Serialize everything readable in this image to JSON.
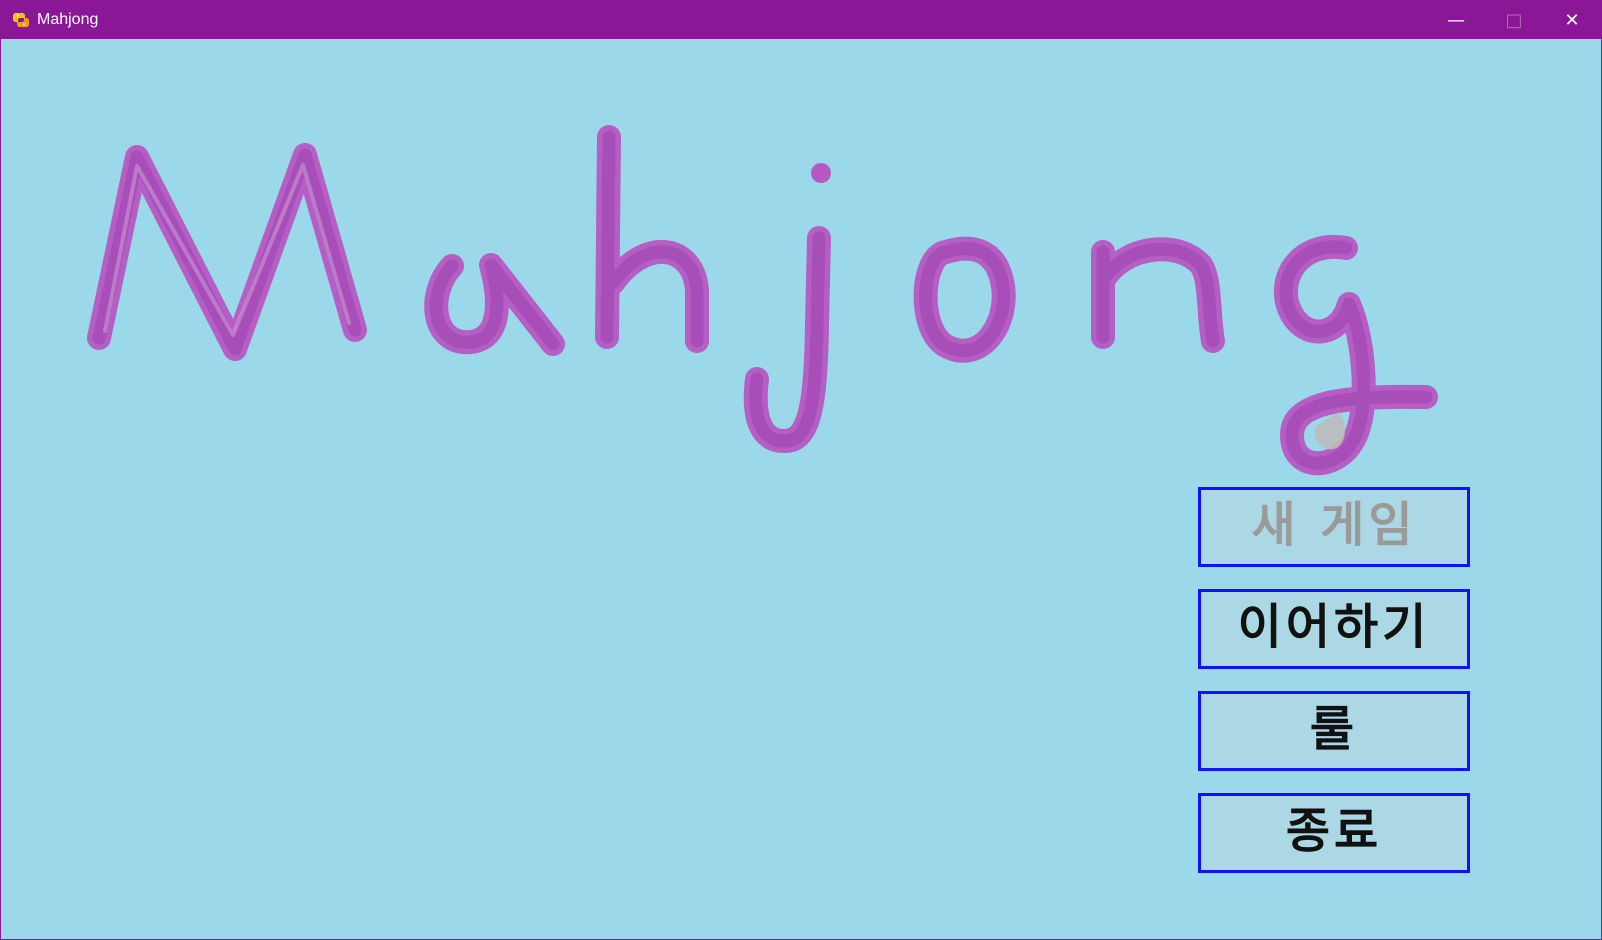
{
  "window": {
    "title": "Mahjong",
    "background": "#9ad8ea",
    "titlebar_color": "#8a1796"
  },
  "controls": {
    "minimize": "—",
    "maximize": "□",
    "close": "✕"
  },
  "logo": {
    "text": "Mahjong",
    "color": "#b659c2"
  },
  "menu": {
    "new_game": "새 게임",
    "continue": "이어하기",
    "rules": "룰",
    "quit": "종료",
    "button_border": "#1111ff",
    "button_fill": "#acd8e6",
    "disabled_text": "#9a9a9a"
  },
  "icons": {
    "app": "python-icon",
    "minimize": "minimize-icon",
    "maximize": "maximize-icon",
    "close": "close-icon"
  }
}
